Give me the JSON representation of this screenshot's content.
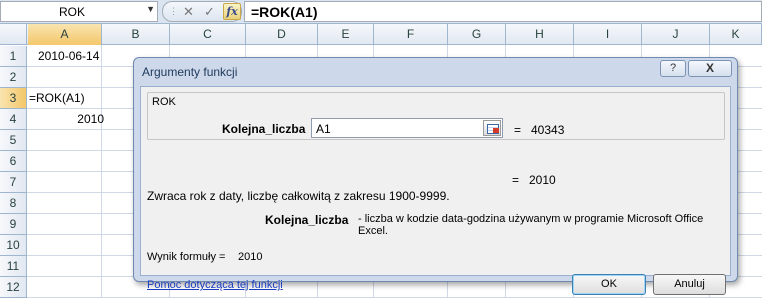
{
  "formula_bar": {
    "name_box": "ROK",
    "name_box_arrow": "▼",
    "cancel_glyph": "✕",
    "enter_glyph": "✓",
    "fx_label": "fx",
    "formula": "=ROK(A1)"
  },
  "columns": [
    "A",
    "B",
    "C",
    "D",
    "E",
    "F",
    "G",
    "H",
    "I",
    "J",
    "K"
  ],
  "rows": [
    "1",
    "2",
    "3",
    "4",
    "5",
    "6",
    "7",
    "8",
    "9",
    "10",
    "11",
    "12"
  ],
  "cells": {
    "A1": "2010-06-14",
    "A3": "=ROK(A1)",
    "A4": "2010"
  },
  "dialog": {
    "title": "Argumenty funkcji",
    "help_glyph": "?",
    "close_glyph": "X",
    "function_name": "ROK",
    "argument_label": "Kolejna_liczba",
    "argument_value": "A1",
    "equals_sign": "=",
    "argument_result": "40343",
    "function_result": "2010",
    "description": "Zwraca rok z daty, liczbę całkowitą z zakresu 1900-9999.",
    "argument_desc_name": "Kolejna_liczba",
    "argument_desc_text": "- liczba w kodzie data-godzina używanym w programie Microsoft Office Excel.",
    "formula_result_label": "Wynik formuły =",
    "formula_result_value": "2010",
    "help_link": "Pomoc dotycząca tej funkcji",
    "ok_label": "OK",
    "cancel_label": "Anuluj"
  }
}
